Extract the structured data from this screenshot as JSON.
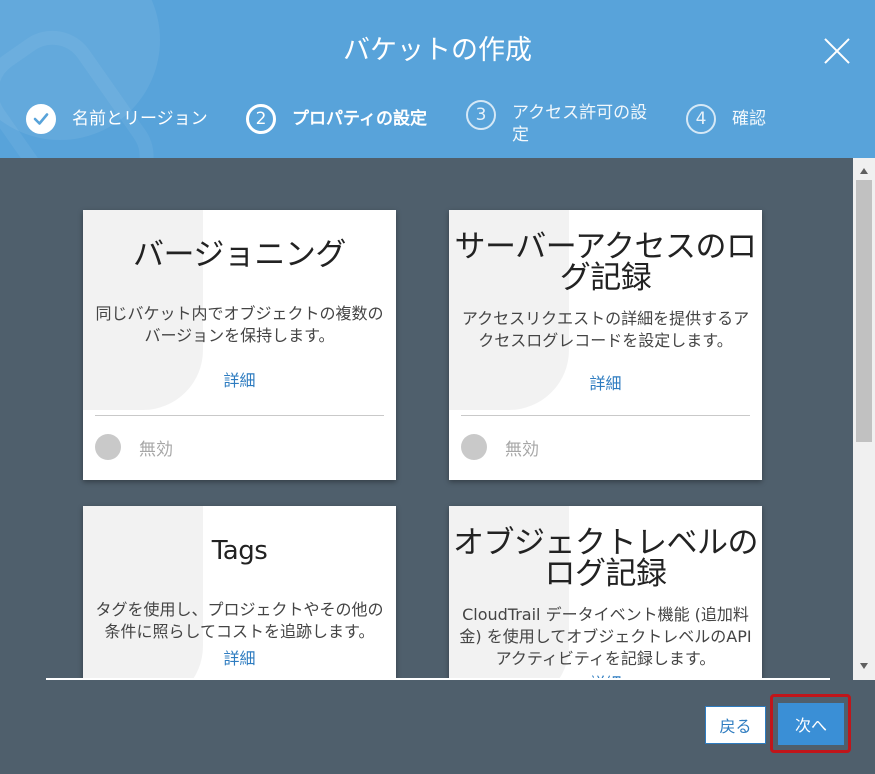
{
  "dialog": {
    "title": "バケットの作成"
  },
  "steps": [
    {
      "number": "",
      "label": "名前とリージョン",
      "state": "done"
    },
    {
      "number": "2",
      "label": "プロパティの設定",
      "state": "current"
    },
    {
      "number": "3",
      "label": "アクセス許可の設\n定",
      "state": "inactive"
    },
    {
      "number": "4",
      "label": "確認",
      "state": "inactive"
    }
  ],
  "cards": [
    {
      "title": "バージョニング",
      "description": "同じバケット内でオブジェクトの複数のバージョンを保持します。",
      "link": "詳細",
      "toggle_label": "無効"
    },
    {
      "title": "サーバーアクセスのロ\nグ記録",
      "description": "アクセスリクエストの詳細を提供するアクセスログレコードを設定します。",
      "link": "詳細",
      "toggle_label": "無効"
    },
    {
      "title": "Tags",
      "description": "タグを使用し、プロジェクトやその他の条件に照らしてコストを追跡します。",
      "link": "詳細"
    },
    {
      "title": "オブジェクトレベルの\nログ記録",
      "description": "CloudTrail データイベント機能 (追加料金) を使用してオブジェクトレベルのAPI アクティビティを記録します。",
      "link": "詳細"
    }
  ],
  "footer": {
    "back_label": "戻る",
    "next_label": "次へ"
  },
  "colors": {
    "header": "#58a3da",
    "body": "#4f5f6c",
    "link": "#2e7cc0",
    "primary_button": "#3a8fd6",
    "highlight": "#c0151a"
  }
}
